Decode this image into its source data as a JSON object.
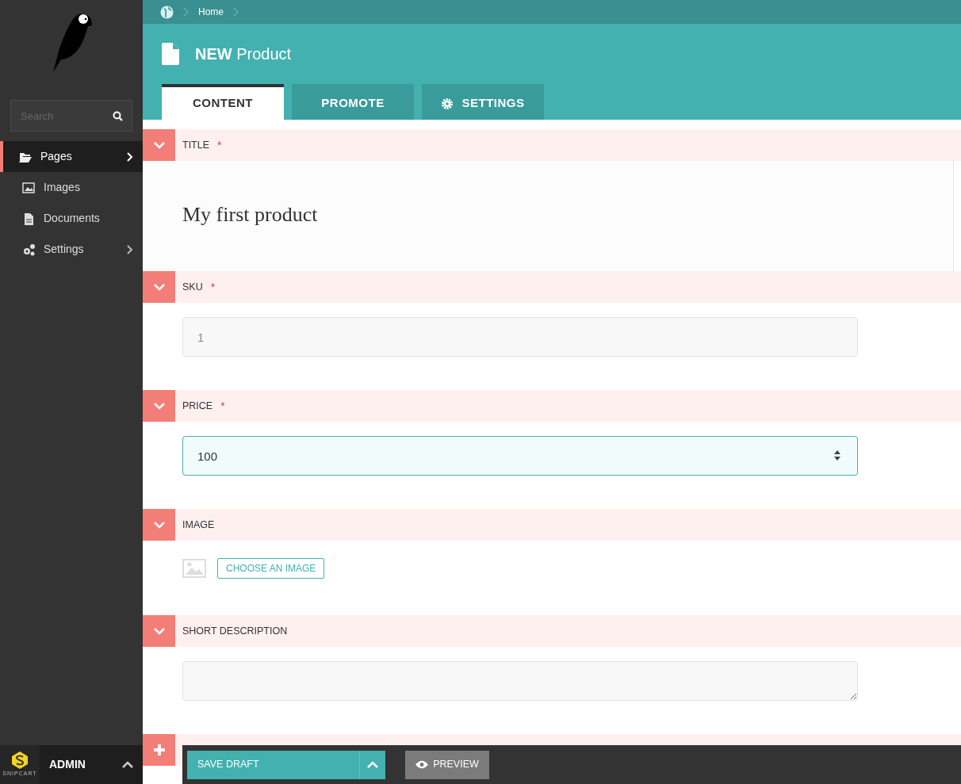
{
  "breadcrumb": [
    {
      "label": "Home"
    }
  ],
  "header": {
    "badge": "NEW",
    "title": "Product"
  },
  "tabs": [
    {
      "label": "CONTENT",
      "selected": true,
      "kind": "plain"
    },
    {
      "label": "PROMOTE",
      "selected": false,
      "kind": "plain"
    },
    {
      "label": "SETTINGS",
      "selected": false,
      "kind": "gear"
    }
  ],
  "search": {
    "placeholder": "Search"
  },
  "sidebar": {
    "items": [
      {
        "label": "Pages",
        "selected": true,
        "expandable": true
      },
      {
        "label": "Images",
        "selected": false,
        "expandable": false
      },
      {
        "label": "Documents",
        "selected": false,
        "expandable": false
      },
      {
        "label": "Settings",
        "selected": false,
        "expandable": true
      }
    ]
  },
  "account": {
    "logo_text": "SNIPCART",
    "user": "ADMIN"
  },
  "fields": [
    {
      "label": "TITLE",
      "marker": "*",
      "kind": "title",
      "value": "My first product"
    },
    {
      "label": "SKU",
      "marker": "*",
      "kind": "text",
      "placeholder": "1",
      "focused": false
    },
    {
      "label": "PRICE",
      "marker": "*",
      "kind": "number",
      "value": "100",
      "focused": true
    },
    {
      "label": "IMAGE",
      "kind": "image",
      "button": "CHOOSE AN IMAGE"
    },
    {
      "label": "SHORT DESCRIPTION",
      "kind": "textarea"
    }
  ],
  "footer": {
    "save": "SAVE DRAFT",
    "preview": "PREVIEW"
  }
}
